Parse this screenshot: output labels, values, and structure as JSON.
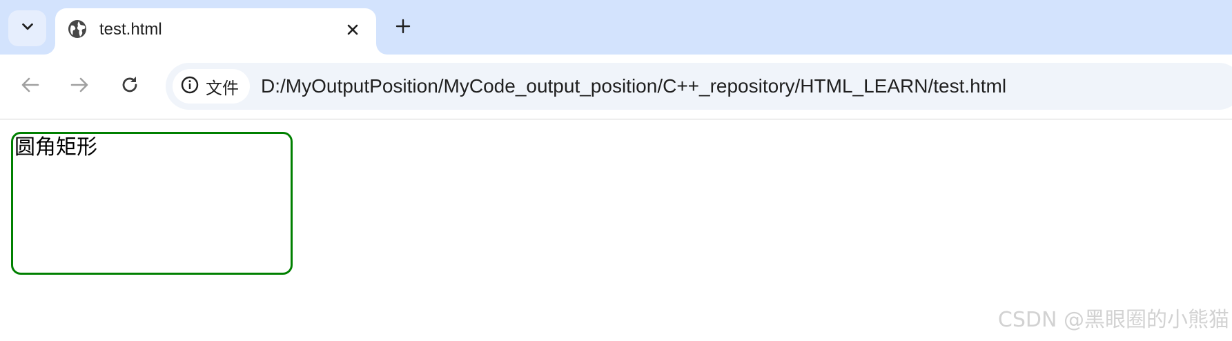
{
  "tab": {
    "title": "test.html"
  },
  "toolbar": {
    "site_info_label": "文件",
    "url": "D:/MyOutputPosition/MyCode_output_position/C++_repository/HTML_LEARN/test.html"
  },
  "page": {
    "box_text": "圆角矩形",
    "box_border_color": "#008000"
  },
  "watermark": {
    "text": "CSDN @黑眼圈的小熊猫"
  },
  "colors": {
    "tabstrip_bg": "#d3e3fd",
    "omnibox_bg": "#f0f4fa"
  },
  "icons": {
    "tab_search": "chevron-down-icon",
    "favicon": "globe-icon",
    "tab_close": "close-icon",
    "new_tab": "plus-icon",
    "back": "arrow-left-icon",
    "forward": "arrow-right-icon",
    "reload": "reload-icon",
    "site_info": "info-icon"
  }
}
